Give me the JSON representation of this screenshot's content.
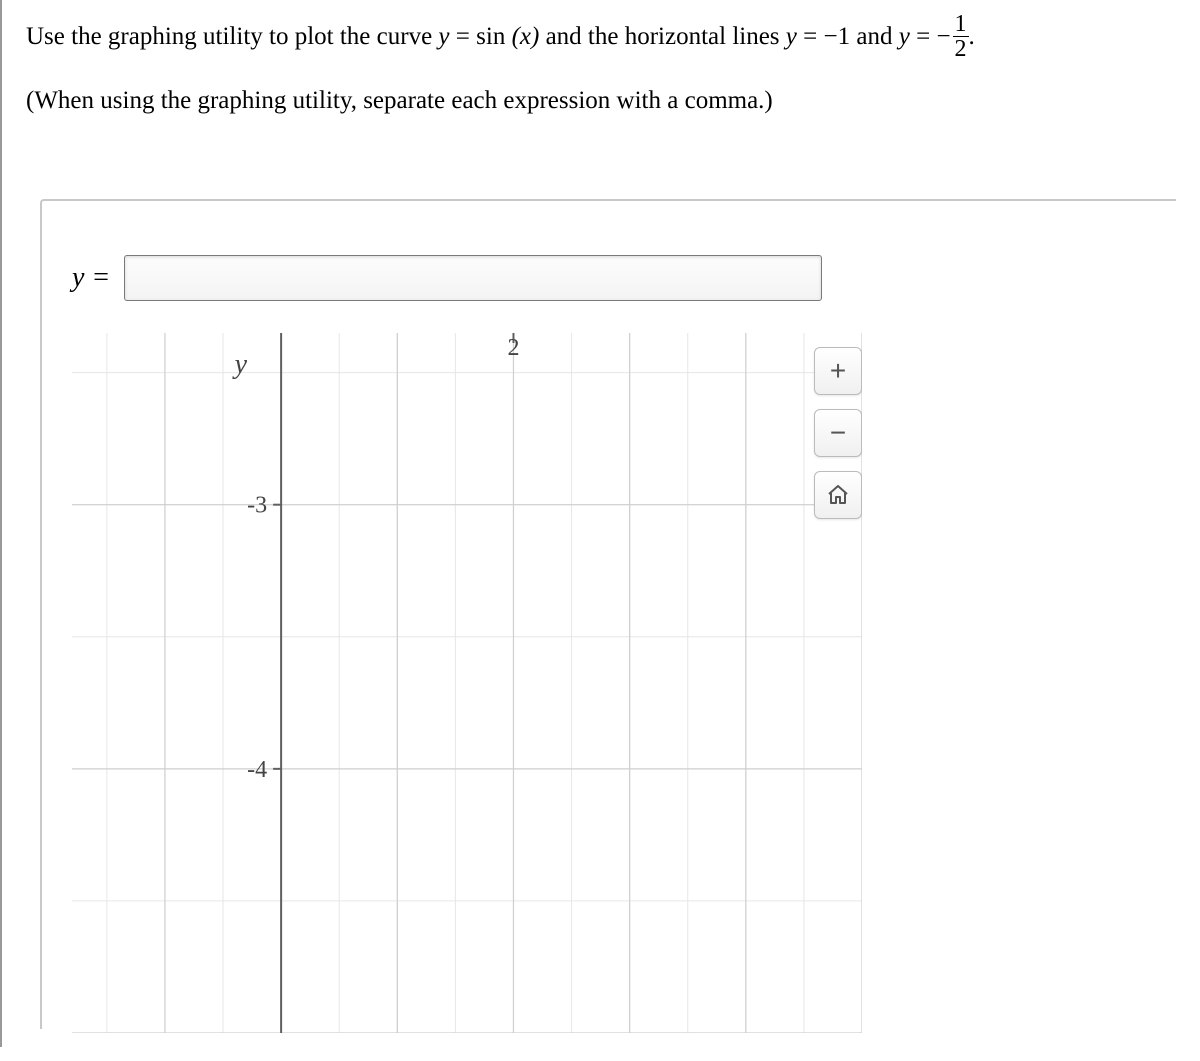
{
  "instruction": {
    "part1": "Use the graphing utility to plot the curve ",
    "yvar": "y",
    "eq": " = ",
    "sin": "sin",
    "xarg": "(x)",
    "part2": " and the horizontal lines ",
    "yvar2": "y",
    "eq2": " = ",
    "neg1": "−1",
    "and": " and ",
    "yvar3": "y",
    "eq3": " = −",
    "frac_num": "1",
    "frac_den": "2",
    "period": "."
  },
  "note": "(When using the graphing utility, separate each expression with a comma.)",
  "input": {
    "label": "y =",
    "value": ""
  },
  "buttons": {
    "zoom_in": "+",
    "zoom_out": "−"
  },
  "chart_data": {
    "type": "line",
    "title": "",
    "xlabel": "",
    "ylabel": "y",
    "xlim": [
      -3.7,
      3.1
    ],
    "ylim": [
      -5.0,
      -2.4
    ],
    "xticks": [
      2
    ],
    "yticks": [
      -3,
      -4
    ],
    "series": []
  }
}
